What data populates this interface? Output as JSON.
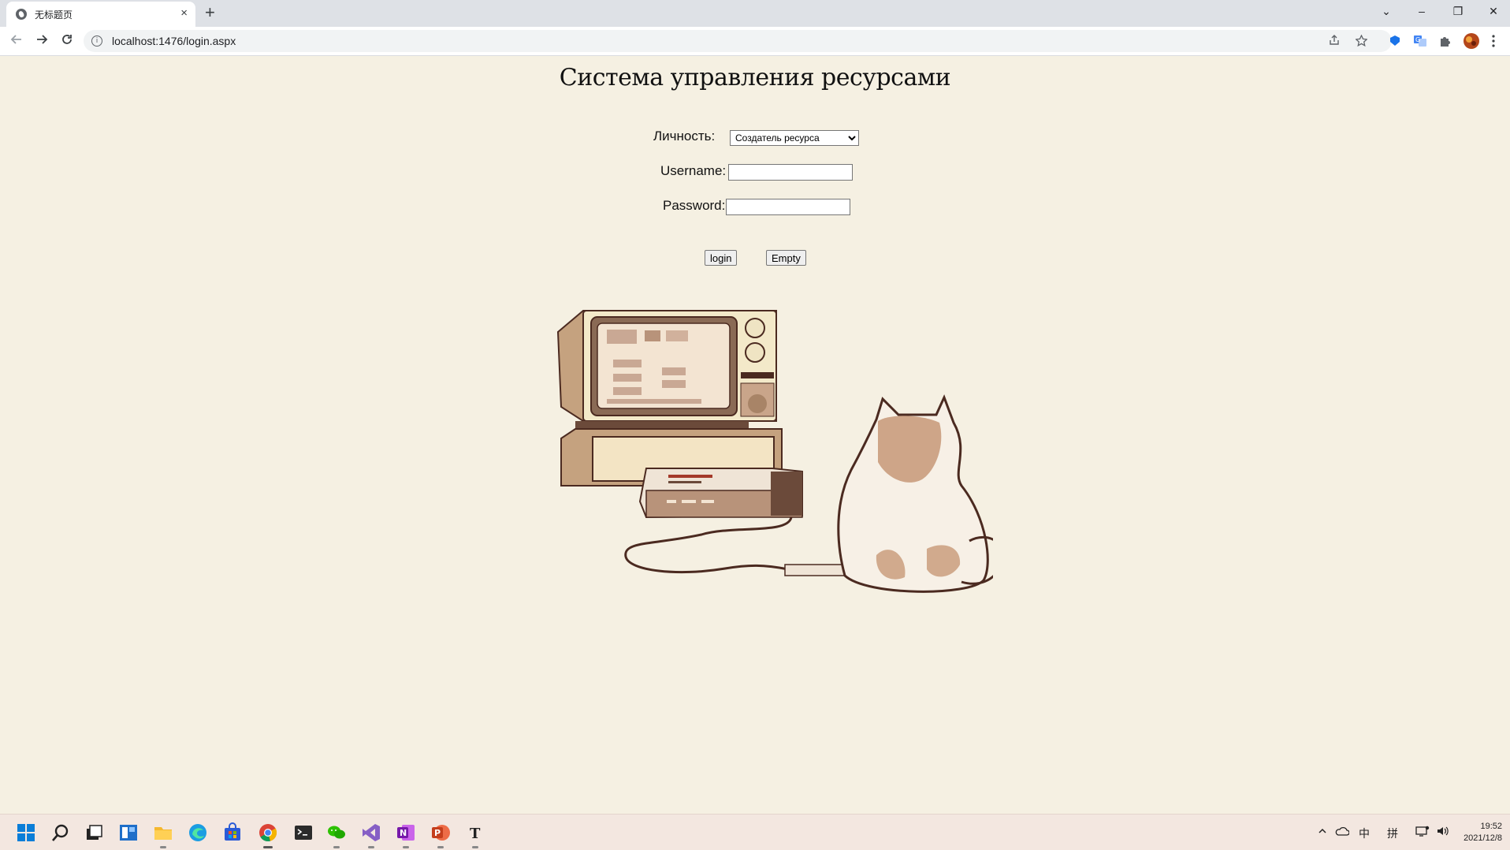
{
  "browser": {
    "tab_title": "无标题页",
    "tab_close": "×",
    "new_tab": "+",
    "url": "localhost:1476/login.aspx",
    "window_controls": {
      "tabsearch": "⌄",
      "minimize": "–",
      "restore": "❐",
      "close": "✕"
    }
  },
  "page": {
    "title": "Система управления ресурсами",
    "role_label": "Личность:",
    "role_selected": "Создатель ресурса",
    "username_label": "Username:",
    "password_label": "Password:",
    "login_button": "login",
    "empty_button": "Empty"
  },
  "taskbar": {
    "apps": [
      "start-icon",
      "search-icon",
      "task-view-icon",
      "widgets-icon",
      "file-explorer-icon",
      "edge-icon",
      "store-icon",
      "chrome-icon",
      "terminal-icon",
      "wechat-icon",
      "visual-studio-icon",
      "onenote-icon",
      "powerpoint-icon",
      "typora-icon"
    ],
    "tray_input_zh": "中",
    "tray_input_pinyin": "拼",
    "time": "19:52",
    "date": "2021/12/8"
  },
  "colors": {
    "page_background": "#f5f0e2",
    "tabbar": "#dee1e6",
    "taskbar": "#f3e7e0"
  }
}
